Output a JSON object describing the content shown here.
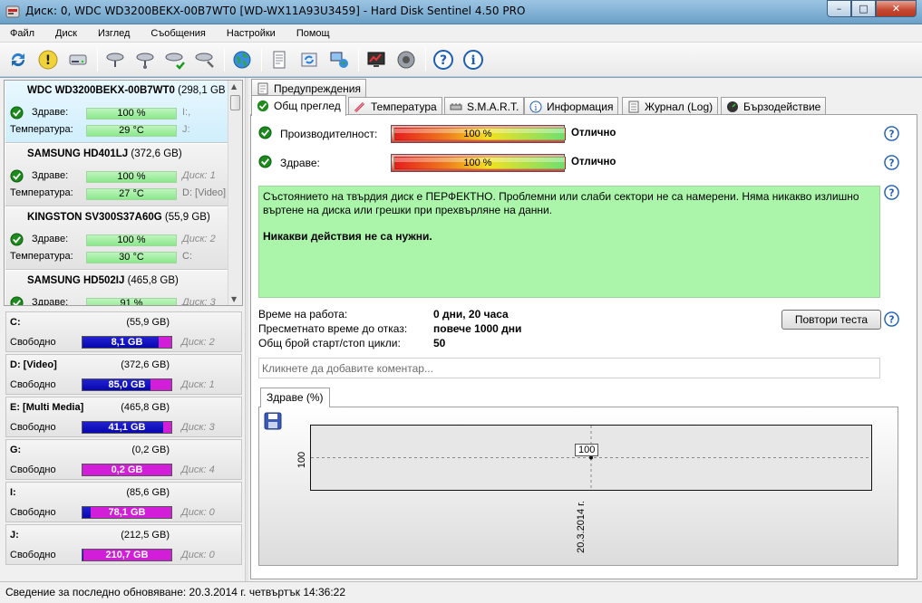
{
  "window": {
    "title": "Диск: 0, WDC WD3200BEKX-00B7WT0 [WD-WX11A93U3459]  -  Hard Disk Sentinel 4.50 PRO",
    "minimize": "–",
    "maximize": "□",
    "close": "✕"
  },
  "menu": [
    "Файл",
    "Диск",
    "Изглед",
    "Съобщения",
    "Настройки",
    "Помощ"
  ],
  "toolbar_icons": [
    "refresh-icon",
    "warning-icon",
    "disk-drive-icon",
    "disk-test-icon",
    "disk-test-2-icon",
    "disk-ok-icon",
    "disk-tools-icon",
    "globe-icon",
    "report-icon",
    "sync-icon",
    "network-icon",
    "monitor-icon",
    "speaker-icon",
    "help-icon",
    "info-icon"
  ],
  "disks": [
    {
      "name": "WDC WD3200BEKX-00B7WT0",
      "size": "(298,1 GB",
      "health_label": "Здраве:",
      "health": "100 %",
      "health_pct": 100,
      "temp_label": "Температура:",
      "temp": "29 °C",
      "tag1": "I:,",
      "tag2": "J:",
      "tag_style": "normal",
      "selected": true
    },
    {
      "name": "SAMSUNG HD401LJ",
      "size": "(372,6 GB)",
      "health_label": "Здраве:",
      "health": "100 %",
      "health_pct": 100,
      "temp_label": "Температура:",
      "temp": "27 °C",
      "tag1": "Диск: 1",
      "tag2": "D: [Video]",
      "tag_style": "italic",
      "selected": false
    },
    {
      "name": "KINGSTON SV300S37A60G",
      "size": "(55,9 GB)",
      "health_label": "Здраве:",
      "health": "100 %",
      "health_pct": 100,
      "temp_label": "Температура:",
      "temp": "30 °C",
      "tag1": "Диск: 2",
      "tag2": "C:",
      "tag_style": "italic",
      "selected": false
    },
    {
      "name": "SAMSUNG HD502IJ",
      "size": "(465,8 GB)",
      "health_label": "Здраве:",
      "health": "91 %",
      "health_pct": 91,
      "temp_label": "",
      "temp": "",
      "tag1": "Диск: 3",
      "tag2": "",
      "tag_style": "italic",
      "selected": false
    }
  ],
  "partitions": [
    {
      "name": "C:",
      "size": "(55,9 GB)",
      "free_label": "Свободно",
      "free": "8,1 GB",
      "used_fraction": 0.855,
      "tag": "Диск: 2"
    },
    {
      "name": "D: [Video]",
      "size": "(372,6 GB)",
      "free_label": "Свободно",
      "free": "85,0 GB",
      "used_fraction": 0.77,
      "tag": "Диск: 1"
    },
    {
      "name": "E: [Multi Media]",
      "size": "(465,8 GB)",
      "free_label": "Свободно",
      "free": "41,1 GB",
      "used_fraction": 0.91,
      "tag": "Диск: 3"
    },
    {
      "name": "G:",
      "size": "(0,2 GB)",
      "free_label": "Свободно",
      "free": "0,2 GB",
      "used_fraction": 0.0,
      "tag": "Диск: 4"
    },
    {
      "name": "I:",
      "size": "(85,6 GB)",
      "free_label": "Свободно",
      "free": "78,1 GB",
      "used_fraction": 0.09,
      "tag": "Диск: 0"
    },
    {
      "name": "J:",
      "size": "(212,5 GB)",
      "free_label": "Свободно",
      "free": "210,7 GB",
      "used_fraction": 0.01,
      "tag": "Диск: 0"
    }
  ],
  "tabs_upper": [
    "Предупреждения"
  ],
  "tabs_lower": [
    "Общ преглед",
    "Температура",
    "S.M.A.R.T.",
    "Информация",
    "Журнал (Log)",
    "Бързодействие"
  ],
  "overview": {
    "performance_label": "Производителност:",
    "performance_value": "100 %",
    "performance_pct": 100,
    "performance_state": "Отлично",
    "health_label": "Здраве:",
    "health_value": "100 %",
    "health_pct": 100,
    "health_state": "Отлично",
    "status_text": "Състоянието на твърдия диск е ПЕРФЕКТНО. Проблемни или слаби сектори не са намерени. Няма никакво излишно въртене на диска или грешки при прехвърляне на данни.",
    "status_action": "Никакви действия не са нужни.",
    "uptime_label": "Време на работа:",
    "uptime_value": "0 дни, 20 часа",
    "lifetime_label": "Пресметнато време до отказ:",
    "lifetime_value": "повече 1000 дни",
    "cycles_label": "Общ брой старт/стоп цикли:",
    "cycles_value": "50",
    "retest_button": "Повтори теста",
    "comment_placeholder": "Кликнете да добавите коментар..."
  },
  "chart_tab": "Здраве (%)",
  "chart_data": {
    "type": "line",
    "x": [
      "20.3.2014 г."
    ],
    "series": [
      {
        "values": [
          100
        ]
      }
    ],
    "point_labels": [
      "100"
    ],
    "ytick_labels": [
      "100"
    ],
    "grid": true
  },
  "statusbar": "Сведение за последно обновяване: 20.3.2014 г. четвъртък 14:36:22",
  "colors": {
    "health_green": "#8be88b",
    "partition_used": "#0808b0",
    "partition_free": "#d21ed8",
    "status_bg": "#aaf5aa"
  }
}
